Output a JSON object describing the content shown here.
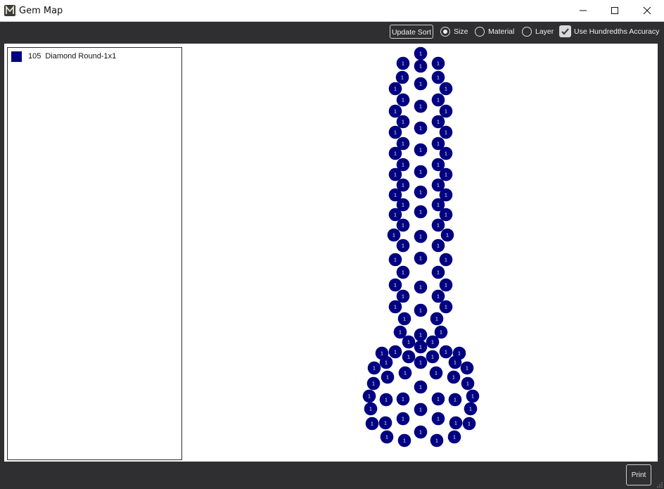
{
  "window": {
    "title": "Gem Map",
    "minimize_glyph": "minimize-icon",
    "maximize_glyph": "maximize-icon",
    "close_glyph": "close-icon"
  },
  "toolbar": {
    "update_sort_label": "Update Sort",
    "sort_options": [
      {
        "label": "Size",
        "selected": true
      },
      {
        "label": "Material",
        "selected": false
      },
      {
        "label": "Layer",
        "selected": false
      }
    ],
    "hundredths_label": "Use Hundredths Accuracy",
    "hundredths_checked": true
  },
  "legend": [
    {
      "count": "105",
      "name": "Diamond Round-1x1",
      "color": "#000080"
    }
  ],
  "map": {
    "gem_color": "#000080",
    "gem_label": "1",
    "gem_count": 105
  },
  "footer": {
    "print_label": "Print"
  },
  "colors": {
    "background": "#2f2f31",
    "panel": "#ffffff",
    "gem": "#000080"
  }
}
